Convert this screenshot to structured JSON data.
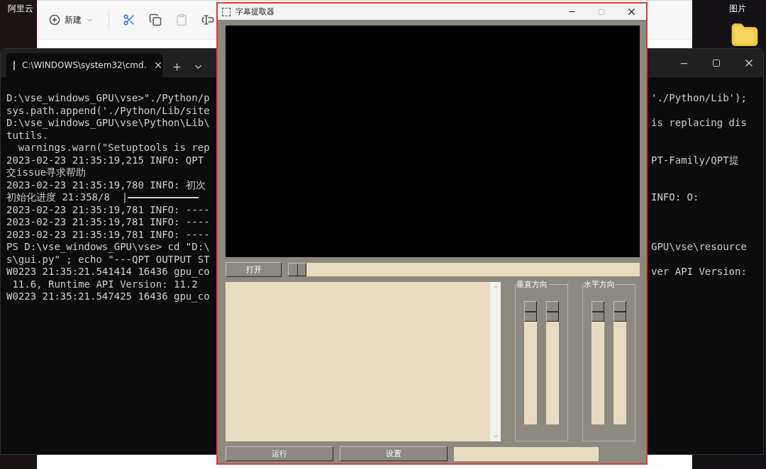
{
  "desktop": {
    "icons": [
      {
        "label": "阿里云"
      },
      {
        "label": "图片"
      }
    ]
  },
  "explorer": {
    "toolbar": [
      {
        "kind": "new",
        "label": "新建",
        "disabled": false
      },
      {
        "kind": "cut",
        "disabled": false
      },
      {
        "kind": "copy",
        "disabled": false
      },
      {
        "kind": "paste",
        "disabled": true
      },
      {
        "kind": "rename",
        "disabled": false
      }
    ]
  },
  "terminal": {
    "tab": {
      "title": "C:\\WINDOWS\\system32\\cmd.",
      "selected": true
    },
    "lines": [
      {
        "left": "D:\\vse_windows_GPU\\vse>\"./Python/p",
        "right": "'./Python/Lib');"
      },
      {
        "left": "sys.path.append('./Python/Lib/site"
      },
      {
        "left": "D:\\vse_windows_GPU\\vse\\Python\\Lib\\",
        "right": "is replacing dis"
      },
      {
        "left": "tutils."
      },
      {
        "left": "  warnings.warn(\"Setuptools is rep"
      },
      {
        "left": "2023-02-23 21:35:19,215 INFO: QPT",
        "right": "PT-Family/QPT提"
      },
      {
        "left": "交issue寻求帮助"
      },
      {
        "left": "2023-02-23 21:35:19,780 INFO: 初次"
      },
      {
        "left": "初始化进度 21:358/8  |",
        "kind": "progress",
        "right": "INFO: O:"
      },
      {
        "left": "2023-02-23 21:35:19,781 INFO: ----"
      },
      {
        "left": "2023-02-23 21:35:19,781 INFO: ----"
      },
      {
        "left": "2023-02-23 21:35:19,781 INFO: ----"
      },
      {
        "left": "PS D:\\vse_windows_GPU\\vse> cd \"D:\\",
        "right": "GPU\\vse\\resource"
      },
      {
        "left": "s\\gui.py\" ; echo \"---QPT OUTPUT ST"
      },
      {
        "left": "W0223 21:35:21.541414 16436 gpu_co",
        "right": "ver API Version:"
      },
      {
        "left": " 11.6, Runtime API Version: 11.2"
      },
      {
        "left": "W0223 21:35:21.547425 16436 gpu_co"
      }
    ]
  },
  "app": {
    "title": "字幕提取器",
    "maximize_disabled": true,
    "open_button": "打开",
    "seek_slider": {
      "level": 0
    },
    "groups": [
      {
        "title": "垂直方向",
        "sliders": [
          {
            "level": 0
          },
          {
            "level": 0
          }
        ]
      },
      {
        "title": "水平方向",
        "sliders": [
          {
            "level": 0
          },
          {
            "level": 0
          }
        ]
      }
    ],
    "buttons": [
      "运行",
      "设置"
    ]
  }
}
